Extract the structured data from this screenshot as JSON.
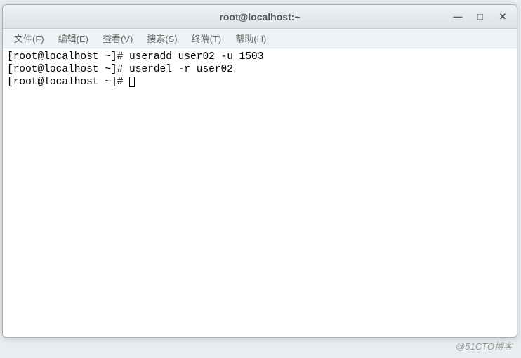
{
  "window": {
    "title": "root@localhost:~"
  },
  "menubar": {
    "file": "文件(F)",
    "edit": "编辑(E)",
    "view": "查看(V)",
    "search": "搜索(S)",
    "terminal": "终端(T)",
    "help": "帮助(H)"
  },
  "terminal": {
    "prompt": "[root@localhost ~]# ",
    "lines": [
      {
        "command": "useradd user02 -u 1503"
      },
      {
        "command": "userdel -r user02"
      },
      {
        "command": ""
      }
    ]
  },
  "controls": {
    "minimize": "—",
    "maximize": "□",
    "close": "✕"
  },
  "watermark": "@51CTO博客"
}
